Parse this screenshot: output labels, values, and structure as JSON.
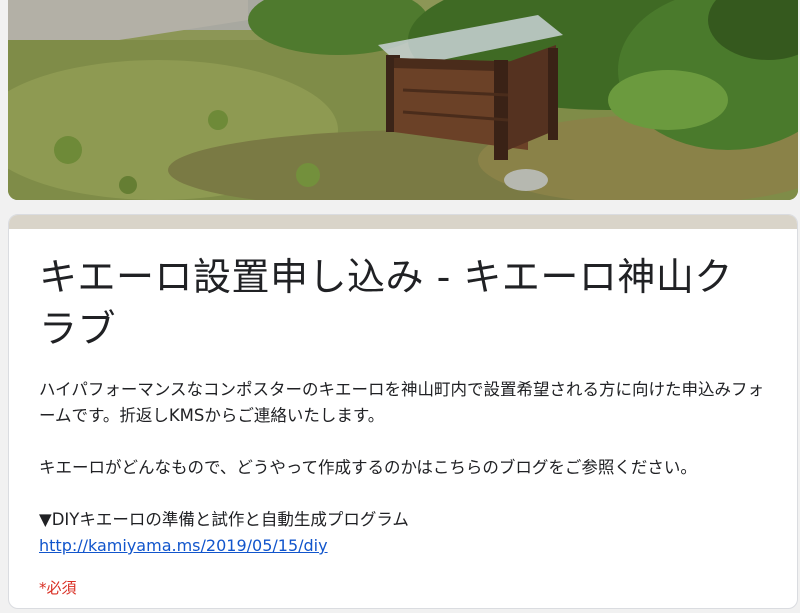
{
  "header": {
    "image_description_icon": "compost-box-photo"
  },
  "form": {
    "title": "キエーロ設置申し込み - キエーロ神山クラブ",
    "description_1": "ハイパフォーマンスなコンポスターのキエーロを神山町内で設置希望される方に向けた申込みフォームです。折返しKMSからご連絡いたします。",
    "description_2": "キエーロがどんなもので、どうやって作成するのかはこちらのブログをご参照ください。",
    "blog_heading": "▼DIYキエーロの準備と試作と自動生成プログラム",
    "blog_link": "http://kamiyama.ms/2019/05/15/diy",
    "required_note": "*必須"
  },
  "colors": {
    "accent_bar": "#d9d4c9",
    "link": "#1155cc",
    "required": "#d93025",
    "background": "#f1f1f1"
  }
}
